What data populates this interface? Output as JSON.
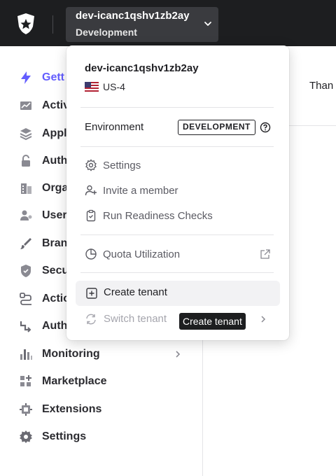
{
  "header": {
    "tenant_name": "dev-icanc1qshv1zb2ay",
    "environment_short": "Development"
  },
  "sidebar": {
    "items": [
      {
        "label": "Gett",
        "icon": "bolt-icon"
      },
      {
        "label": "Activ",
        "icon": "activity-icon"
      },
      {
        "label": "Appl",
        "icon": "applications-icon"
      },
      {
        "label": "Auth",
        "icon": "lock-icon"
      },
      {
        "label": "Orga",
        "icon": "organizations-icon"
      },
      {
        "label": "User",
        "icon": "user-management-icon"
      },
      {
        "label": "Bran",
        "icon": "brush-icon"
      },
      {
        "label": "Secu",
        "icon": "shield-icon"
      },
      {
        "label": "Actio",
        "icon": "actions-icon"
      },
      {
        "label": "Auth",
        "icon": "auth-pipeline-icon"
      },
      {
        "label": "Monitoring",
        "icon": "bar-chart-icon"
      },
      {
        "label": "Marketplace",
        "icon": "marketplace-icon"
      },
      {
        "label": "Extensions",
        "icon": "puzzle-icon"
      },
      {
        "label": "Settings",
        "icon": "gear-icon"
      }
    ]
  },
  "main": {
    "peek_text": "Than"
  },
  "dropdown": {
    "tenant_name": "dev-icanc1qshv1zb2ay",
    "region": "US-4",
    "environment_label": "Environment",
    "environment_badge": "DEVELOPMENT",
    "settings_label": "Settings",
    "invite_label": "Invite a member",
    "readiness_label": "Run Readiness Checks",
    "quota_label": "Quota Utilization",
    "create_tenant_label": "Create tenant",
    "switch_tenant_label": "Switch tenant"
  },
  "tooltip": {
    "text": "Create tenant"
  },
  "colors": {
    "accent": "#635dff",
    "topbar": "#1d1e20",
    "switcher": "#3a3b3f"
  }
}
